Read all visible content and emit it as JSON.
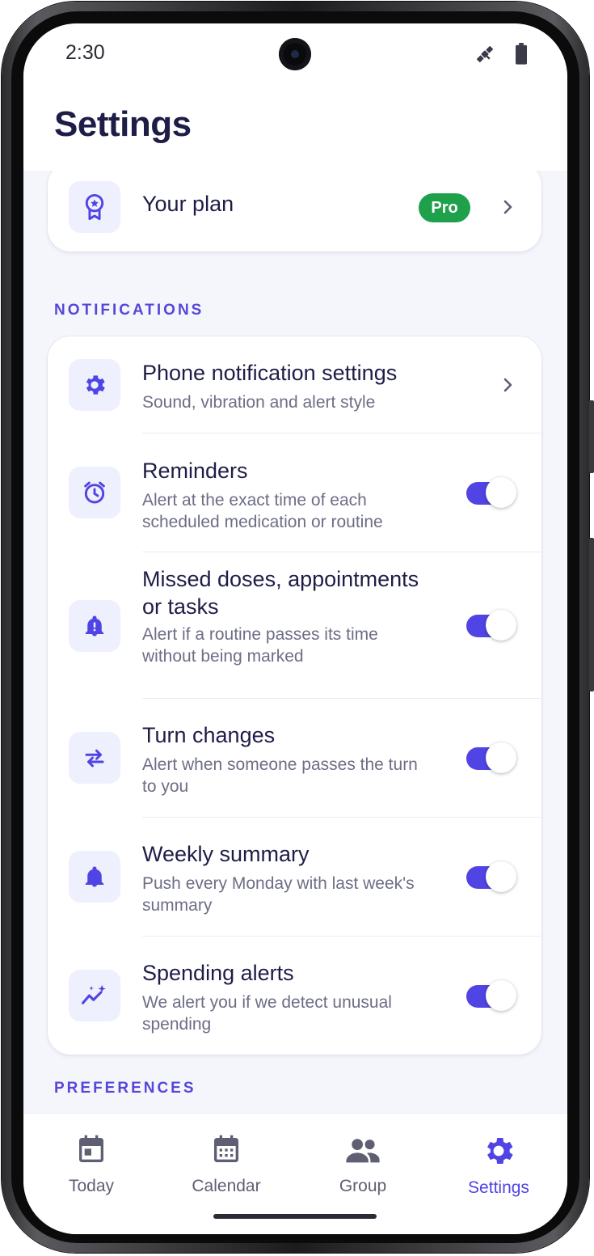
{
  "status_bar": {
    "time": "2:30"
  },
  "page": {
    "title": "Settings"
  },
  "plan": {
    "label": "Your plan",
    "badge": "Pro"
  },
  "sections": {
    "notifications": "NOTIFICATIONS",
    "preferences": "PREFERENCES"
  },
  "notifications": {
    "phone_settings": {
      "title": "Phone notification settings",
      "subtitle": "Sound, vibration and alert style"
    },
    "rows": [
      {
        "title": "Reminders",
        "subtitle": "Alert at the exact time of each scheduled medication or routine",
        "enabled": true
      },
      {
        "title": "Missed doses, appointments or tasks",
        "subtitle": "Alert if a routine passes its time without being marked",
        "enabled": true
      },
      {
        "title": "Turn changes",
        "subtitle": "Alert when someone passes the turn to you",
        "enabled": true
      },
      {
        "title": "Weekly summary",
        "subtitle": "Push every Monday with last week's summary",
        "enabled": true
      },
      {
        "title": "Spending alerts",
        "subtitle": "We alert you if we detect unusual spending",
        "enabled": true
      }
    ]
  },
  "nav": {
    "items": [
      {
        "label": "Today",
        "icon": "calendar-today-icon"
      },
      {
        "label": "Calendar",
        "icon": "calendar-month-icon"
      },
      {
        "label": "Group",
        "icon": "group-icon"
      },
      {
        "label": "Settings",
        "icon": "gear-icon",
        "active": true
      }
    ]
  },
  "colors": {
    "accent": "#5044e4",
    "title": "#1e1d47",
    "subtitle": "#6d6e85",
    "badge": "#1ea14a",
    "section_label": "#5647d9",
    "icon_tile": "#eef0fd"
  }
}
